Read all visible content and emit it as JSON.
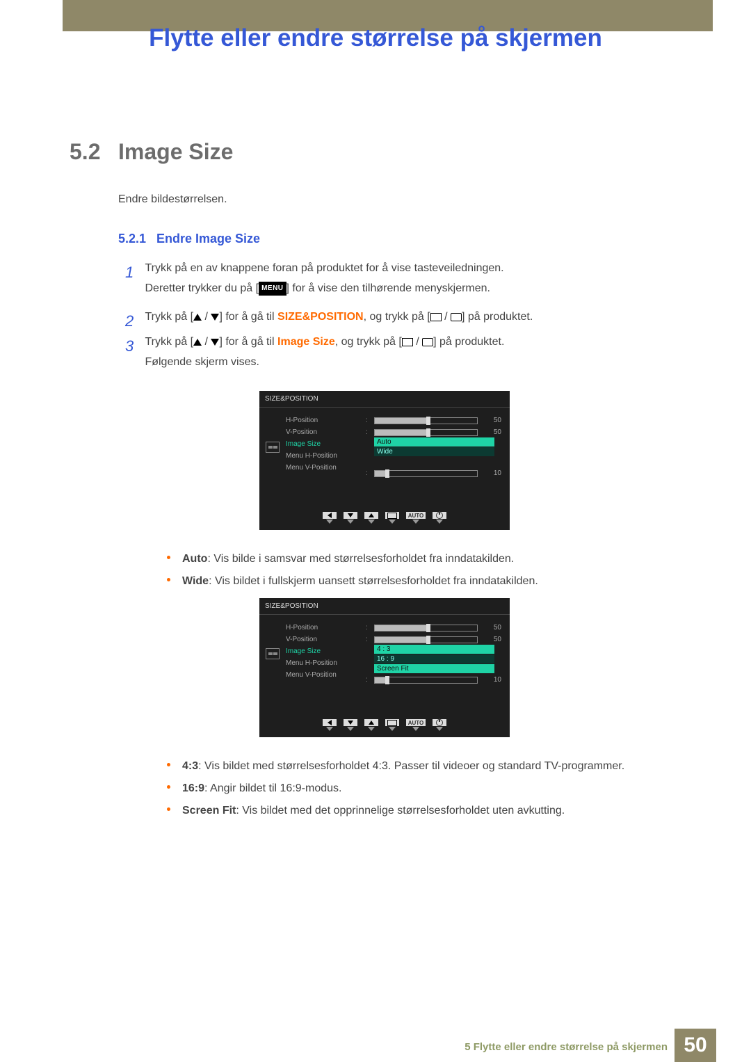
{
  "header": {
    "title": "Flytte eller endre størrelse på skjermen"
  },
  "section": {
    "num": "5.2",
    "title": "Image Size",
    "desc": "Endre bildestørrelsen."
  },
  "subsection": {
    "num": "5.2.1",
    "title": "Endre Image Size"
  },
  "steps": {
    "s1_a": "Trykk på en av knappene foran på produktet for å vise tasteveiledningen.",
    "s1_b_pre": "Deretter trykker du på [",
    "s1_b_menu": "MENU",
    "s1_b_post": "] for å vise den tilhørende menyskjermen.",
    "s2_pre": "Trykk på [",
    "s2_mid": "] for å gå til ",
    "s2_em": "SIZE&POSITION",
    "s2_post1": ", og trykk på [",
    "s2_post2": "] på produktet.",
    "s3_pre": "Trykk på [",
    "s3_mid": "] for å gå til ",
    "s3_em": "Image Size",
    "s3_post1": ", og trykk på [",
    "s3_post2": "] på produktet.",
    "s3_follow": "Følgende skjerm vises."
  },
  "osd": {
    "title": "SIZE&POSITION",
    "rows": {
      "hpos": "H-Position",
      "vpos": "V-Position",
      "imgsize": "Image Size",
      "mhpos": "Menu H-Position",
      "mvpos": "Menu V-Position"
    },
    "vals": {
      "hpos": "50",
      "vpos": "50",
      "mvpos": "10"
    },
    "dd1": {
      "opt1": "Auto",
      "opt2": "Wide"
    },
    "dd2": {
      "opt1": "4 : 3",
      "opt2": "16 : 9",
      "opt3": "Screen Fit"
    },
    "footer": {
      "auto": "AUTO"
    }
  },
  "bullets1": {
    "auto_l": "Auto",
    "auto_t": ": Vis bilde i samsvar med størrelsesforholdet fra inndatakilden.",
    "wide_l": "Wide",
    "wide_t": ": Vis bildet i fullskjerm uansett størrelsesforholdet fra inndatakilden."
  },
  "bullets2": {
    "b43_l": "4:3",
    "b43_t": ": Vis bildet med størrelsesforholdet 4:3. Passer til videoer og standard TV-programmer.",
    "b169_l": "16:9",
    "b169_t": ": Angir bildet til 16:9-modus.",
    "fit_l": "Screen Fit",
    "fit_t": ": Vis bildet med det opprinnelige størrelsesforholdet uten avkutting."
  },
  "footer": {
    "chapter": "5 Flytte eller endre størrelse på skjermen",
    "page": "50"
  }
}
